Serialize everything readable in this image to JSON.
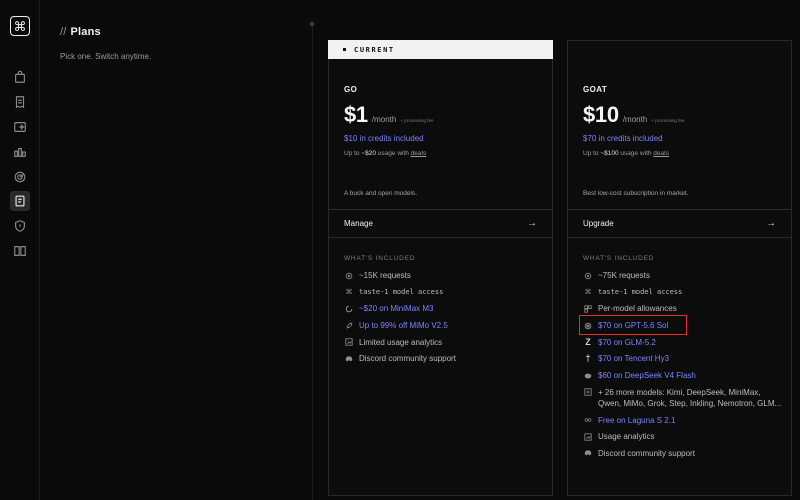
{
  "app": {
    "logo_glyph": "⌘"
  },
  "rail": {
    "icons": [
      "bag-icon",
      "receipt-icon",
      "sparkle-window-icon",
      "chart-bars-icon",
      "radar-icon",
      "clipboard-icon",
      "shield-icon",
      "book-icon"
    ],
    "active_index": 5
  },
  "section": {
    "slash": "//",
    "title": "Plans",
    "subtitle": "Pick one. Switch anytime."
  },
  "plans": {
    "go": {
      "banner": "CURRENT",
      "name": "GO",
      "price": "$1",
      "per": "/month",
      "fee": "+ processing fee",
      "credits": "$10 in credits included",
      "usage_prefix": "Up to ",
      "usage_amount": "~$20",
      "usage_mid": " usage with ",
      "usage_link": "deals",
      "desc": "A buck and open models.",
      "action": "Manage",
      "included_heading": "WHAT'S INCLUDED",
      "features": [
        {
          "icon": "requests-icon",
          "text": "~15K requests",
          "link": false
        },
        {
          "icon": "command-icon",
          "text": "taste-1 model access",
          "link": false
        },
        {
          "icon": "circle-icon",
          "text": "~$20 on MiniMax M3",
          "link": true
        },
        {
          "icon": "rocket-icon",
          "text": "Up to 99% off MiMo V2.5",
          "link": true
        },
        {
          "icon": "chart-icon",
          "text": "Limited usage analytics",
          "link": false
        },
        {
          "icon": "discord-icon",
          "text": "Discord community support",
          "link": false
        }
      ]
    },
    "goat": {
      "name": "GOAT",
      "price": "$10",
      "per": "/month",
      "fee": "+ processing fee",
      "credits": "$70 in credits included",
      "usage_prefix": "Up to ",
      "usage_amount": "~$100",
      "usage_mid": " usage with ",
      "usage_link": "deals",
      "desc": "Best low-cost subscription in market.",
      "action": "Upgrade",
      "included_heading": "WHAT'S INCLUDED",
      "features": [
        {
          "icon": "requests-icon",
          "text": "~75K requests",
          "link": false
        },
        {
          "icon": "command-icon",
          "text": "taste-1 model access",
          "link": false
        },
        {
          "icon": "allowance-icon",
          "text": "Per-model allowances",
          "link": false
        },
        {
          "icon": "openai-icon",
          "text": "$70 on GPT-5.6 Sol",
          "link": true
        },
        {
          "icon": "zhipu-icon",
          "text": "$70 on GLM-5.2",
          "link": true
        },
        {
          "icon": "tencent-icon",
          "text": "$70 on Tencent Hy3",
          "link": true
        },
        {
          "icon": "whale-icon",
          "text": "$60 on DeepSeek V4 Flash",
          "link": true
        },
        {
          "icon": "plus-icon",
          "text": "+ 26 more models: Kimi, DeepSeek, MiniMax, Qwen, MiMo, Grok, Step, Inkling, Nemotron, GLM...",
          "link": false
        },
        {
          "icon": "infinity-icon",
          "text": "Free on Laguna S 2.1",
          "link": true
        },
        {
          "icon": "chart-icon",
          "text": "Usage analytics",
          "link": false
        },
        {
          "icon": "discord-icon",
          "text": "Discord community support",
          "link": false
        }
      ]
    }
  },
  "colors": {
    "accent": "#7b84ff",
    "highlight": "#e0302a",
    "background": "#0a0a0a"
  }
}
